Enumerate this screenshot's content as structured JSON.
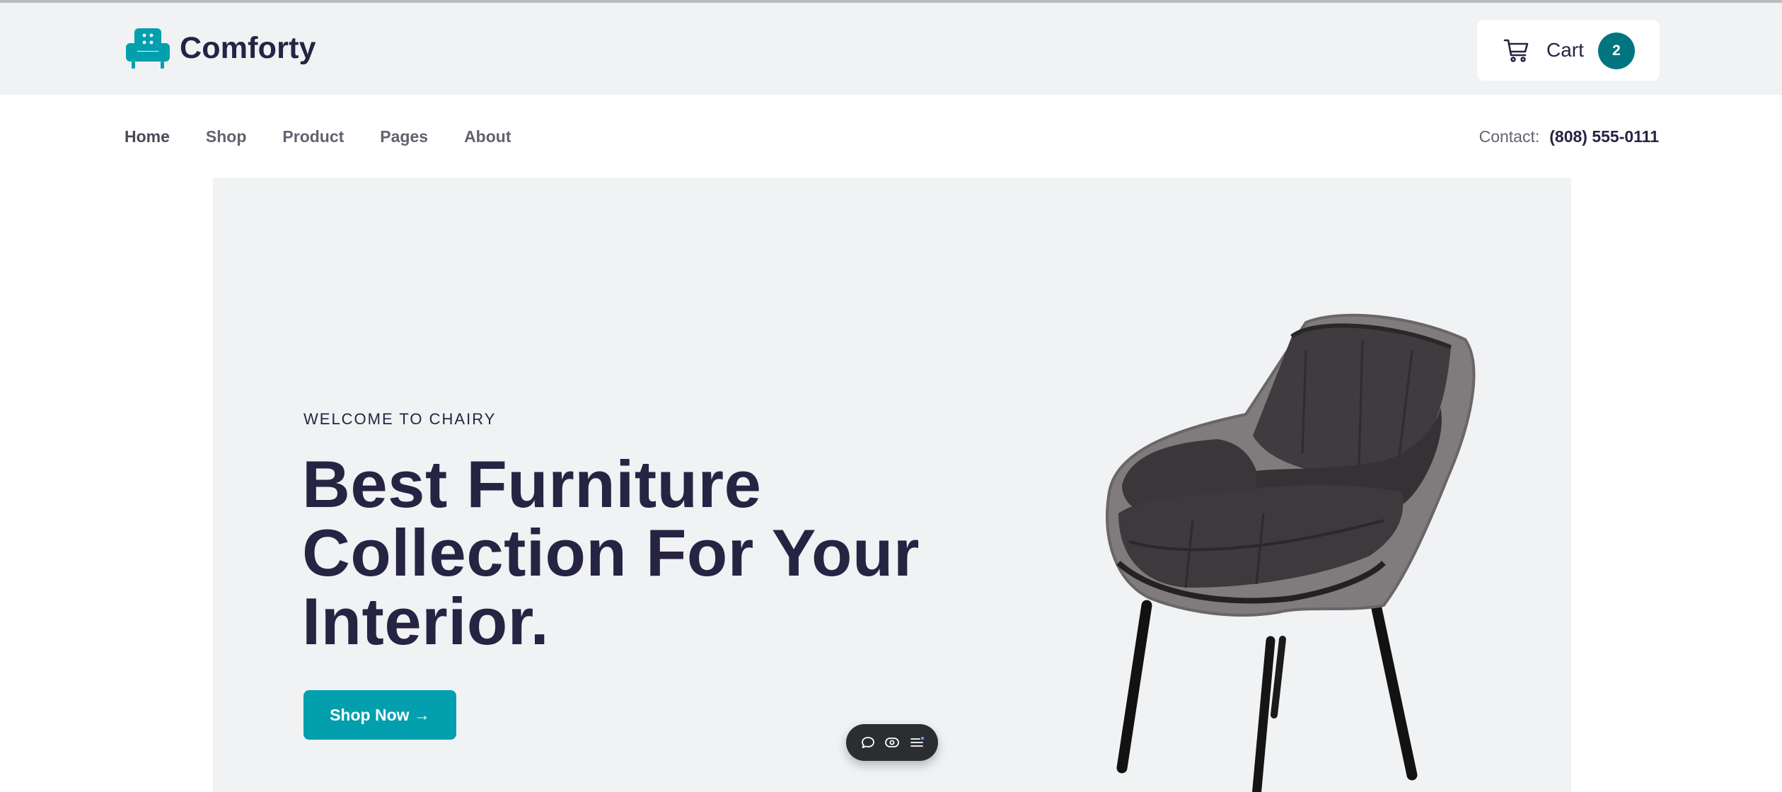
{
  "brand": {
    "name": "Comforty",
    "logo_icon": "armchair-icon",
    "accent_color": "#029fae"
  },
  "cart": {
    "icon": "shopping-cart-icon",
    "label": "Cart",
    "count": "2",
    "badge_color": "#007580"
  },
  "nav": {
    "items": [
      {
        "label": "Home"
      },
      {
        "label": "Shop"
      },
      {
        "label": "Product"
      },
      {
        "label": "Pages"
      },
      {
        "label": "About"
      }
    ],
    "contact_label": "Contact:",
    "contact_phone": "(808) 555-0111"
  },
  "hero": {
    "eyebrow": "WELCOME TO CHAIRY",
    "title": "Best Furniture Collection For Your Interior.",
    "button_label": "Shop Now →",
    "image": "armchair-product-image",
    "title_color": "#272343"
  },
  "floating_toolbar": {
    "icons": [
      "comment-icon",
      "eye-icon",
      "menu-list-icon"
    ]
  }
}
